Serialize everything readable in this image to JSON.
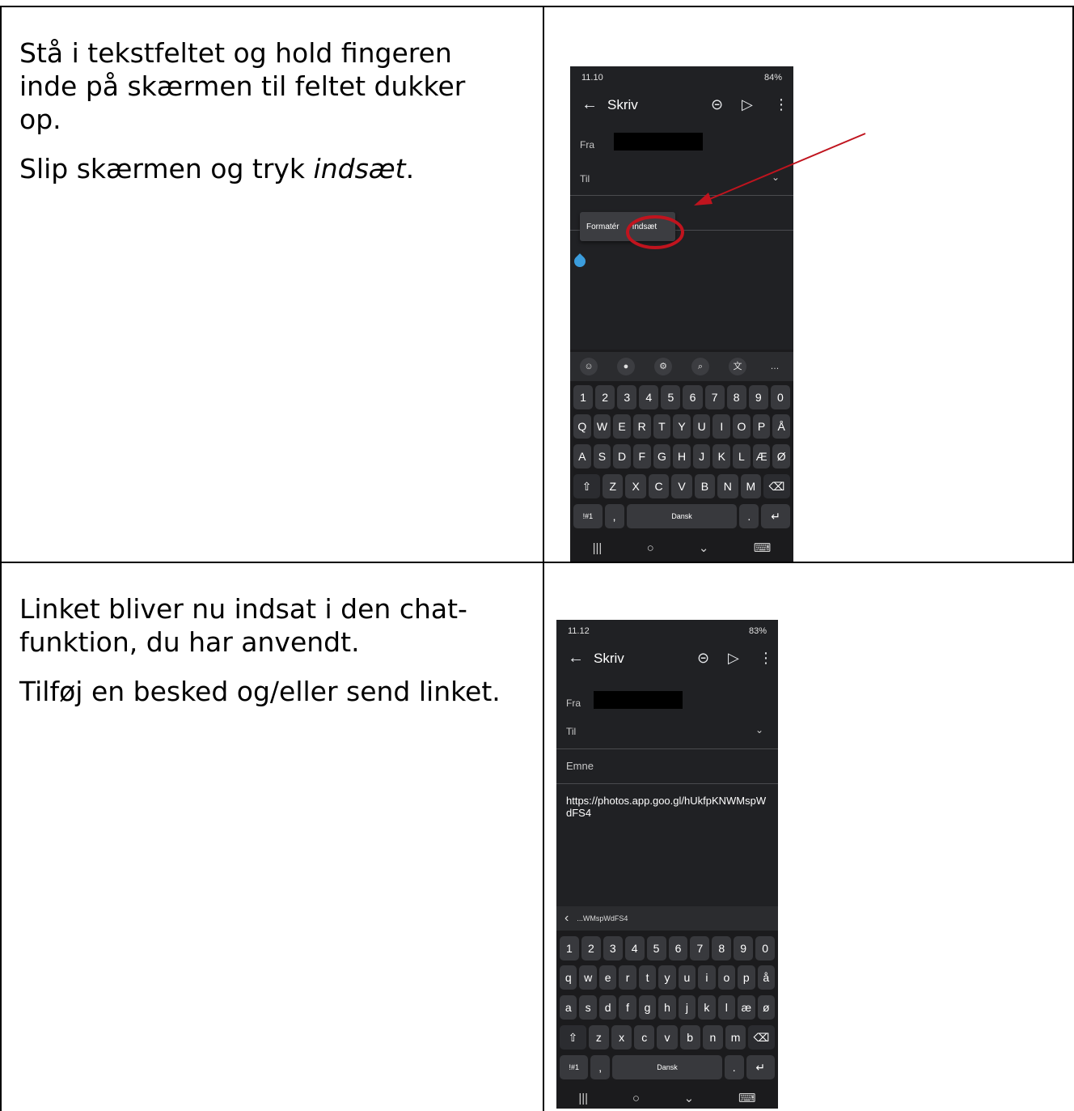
{
  "rows": [
    {
      "paragraphs": [
        "Stå i tekstfeltet og hold fingeren inde på skærmen til feltet dukker op."
      ],
      "instruction_prefix": "Slip skærmen og tryk ",
      "instruction_emphasis": "indsæt",
      "instruction_suffix": "."
    },
    {
      "paragraphs": [
        "Linket bliver nu indsat i den chat-funktion, du har anvendt.",
        "Tilføj en besked og/eller send linket."
      ]
    }
  ],
  "phone1": {
    "status_time": "11.10",
    "status_battery": "84%",
    "title": "Skriv",
    "from_label": "Fra",
    "to_label": "Til",
    "menu_format": "Formatér",
    "menu_paste": "Indsæt",
    "space_label": "Dansk",
    "sym_label": "!#1",
    "rows": [
      [
        "1",
        "2",
        "3",
        "4",
        "5",
        "6",
        "7",
        "8",
        "9",
        "0"
      ],
      [
        "Q",
        "W",
        "E",
        "R",
        "T",
        "Y",
        "U",
        "I",
        "O",
        "P",
        "Å"
      ],
      [
        "A",
        "S",
        "D",
        "F",
        "G",
        "H",
        "J",
        "K",
        "L",
        "Æ",
        "Ø"
      ],
      [
        "⇧",
        "Z",
        "X",
        "C",
        "V",
        "B",
        "N",
        "M",
        "⌫"
      ]
    ]
  },
  "phone2": {
    "status_time": "11.12",
    "status_battery": "83%",
    "title": "Skriv",
    "from_label": "Fra",
    "to_label": "Til",
    "subject_label": "Emne",
    "body": "https://photos.app.goo.gl/hUkfpKNWMspWdFS4",
    "suggestion": "...WMspWdFS4",
    "space_label": "Dansk",
    "sym_label": "!#1",
    "rows": [
      [
        "1",
        "2",
        "3",
        "4",
        "5",
        "6",
        "7",
        "8",
        "9",
        "0"
      ],
      [
        "q",
        "w",
        "e",
        "r",
        "t",
        "y",
        "u",
        "i",
        "o",
        "p",
        "å"
      ],
      [
        "a",
        "s",
        "d",
        "f",
        "g",
        "h",
        "j",
        "k",
        "l",
        "æ",
        "ø"
      ],
      [
        "⇧",
        "z",
        "x",
        "c",
        "v",
        "b",
        "n",
        "m",
        "⌫"
      ]
    ]
  },
  "colors": {
    "annotation": "#c0141e",
    "phone_bg": "#202124"
  }
}
